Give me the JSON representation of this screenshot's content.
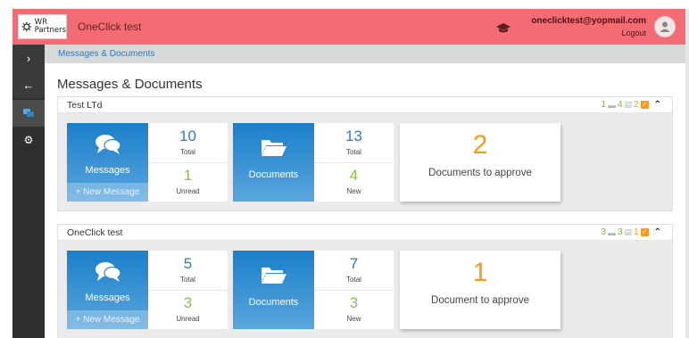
{
  "header": {
    "logo_line1": "WR",
    "logo_line2": "Partners",
    "app_title": "OneClick test",
    "user_email": "oneclicktest@yopmail.com",
    "logout_label": "Logout"
  },
  "breadcrumb": "Messages & Documents",
  "page_title": "Messages & Documents",
  "companies": [
    {
      "name": "Test LTd",
      "stats": {
        "messages": "1",
        "docs": "4",
        "folders": "2"
      },
      "messages_label": "Messages",
      "new_message_label": "+ New Message",
      "messages_total": "10",
      "messages_total_label": "Total",
      "messages_unread": "1",
      "messages_unread_label": "Unread",
      "documents_label": "Documents",
      "documents_total": "13",
      "documents_total_label": "Total",
      "documents_new": "4",
      "documents_new_label": "New",
      "approve_count": "2",
      "approve_label": "Documents to approve"
    },
    {
      "name": "OneClick test",
      "stats": {
        "messages": "3",
        "docs": "3",
        "folders": "1"
      },
      "messages_label": "Messages",
      "new_message_label": "+ New Message",
      "messages_total": "5",
      "messages_total_label": "Total",
      "messages_unread": "3",
      "messages_unread_label": "Unread",
      "documents_label": "Documents",
      "documents_total": "7",
      "documents_total_label": "Total",
      "documents_new": "3",
      "documents_new_label": "New",
      "approve_count": "1",
      "approve_label": "Document to approve"
    }
  ],
  "colors": {
    "header": "#f46c73",
    "sidebar": "#2f2f2f",
    "tile_blue": "#1a7fc9",
    "accent_orange": "#f59b22",
    "accent_green": "#8cc152"
  },
  "icons": {
    "sidebar": [
      "chevron-right-icon",
      "arrow-left-icon",
      "messages-icon",
      "gear-icon"
    ],
    "header": [
      "graduation-cap-icon",
      "user-avatar-icon"
    ]
  }
}
